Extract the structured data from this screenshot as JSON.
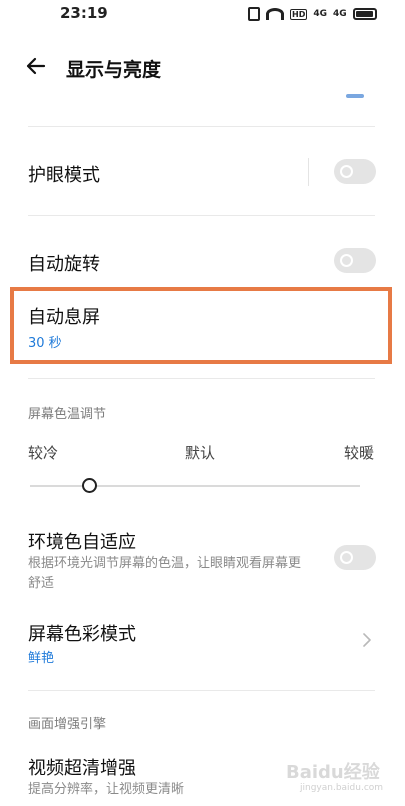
{
  "status_bar": {
    "time": "23:19",
    "hd": "HD",
    "signal1": "4G",
    "signal2": "4G"
  },
  "header": {
    "title": "显示与亮度"
  },
  "items": {
    "eye_care": {
      "title": "护眼模式",
      "enabled": false
    },
    "auto_rotate": {
      "title": "自动旋转",
      "enabled": false
    },
    "auto_screen_off": {
      "title": "自动息屏",
      "value": "30 秒"
    },
    "ambient_adapt": {
      "title": "环境色自适应",
      "desc_line1": "根据环境光调节屏幕的色温，让眼睛观看屏幕更",
      "desc_line2": "舒适",
      "enabled": false
    },
    "color_mode": {
      "title": "屏幕色彩模式",
      "value": "鲜艳"
    },
    "video_enhance": {
      "title": "视频超清增强",
      "desc": "提高分辨率，让视频更清晰"
    }
  },
  "color_temp": {
    "section_label": "屏幕色温调节",
    "label_cool": "较冷",
    "label_default": "默认",
    "label_warm": "较暖",
    "level": 0.18
  },
  "section_image_enhance": "画面增强引擎",
  "watermark": {
    "brand": "Baidu经验",
    "site": "jingyan.baidu.com"
  },
  "colors": {
    "accent_blue": "#1f7ad9",
    "highlight_orange": "#e77a45",
    "toggle_off": "#e4e4e4"
  },
  "icons": {
    "back": "back-arrow-icon",
    "chevron": "chevron-right-icon"
  }
}
